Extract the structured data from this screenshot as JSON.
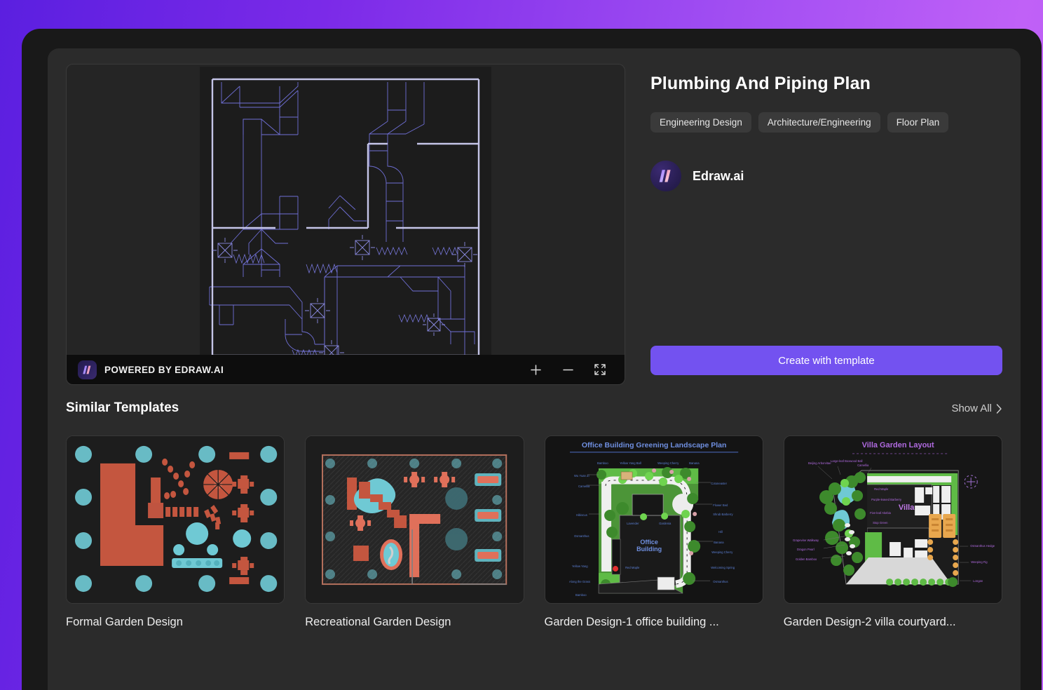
{
  "theme": {
    "bg_gradient_from": "#5b1fe0",
    "bg_gradient_to": "#c061f7",
    "window_bg": "#2b2b2b",
    "frame_bg": "#191919",
    "accent": "#7352f0",
    "tag_bg": "#3a3a3a",
    "cad_line": "#8d8de0",
    "cad_bg": "#1c1c1c"
  },
  "preview": {
    "watermark_text": "POWERED BY EDRAW.AI",
    "logo_icon": "edraw-logo-icon",
    "controls": [
      {
        "name": "zoom-in-button",
        "icon": "plus-icon"
      },
      {
        "name": "zoom-out-button",
        "icon": "minus-icon"
      },
      {
        "name": "fullscreen-button",
        "icon": "expand-icon"
      }
    ]
  },
  "detail": {
    "title": "Plumbing And Piping Plan",
    "tags": [
      "Engineering Design",
      "Architecture/Engineering",
      "Floor Plan"
    ],
    "author": {
      "name": "Edraw.ai",
      "avatar_icon": "edraw-avatar-icon"
    },
    "cta_label": "Create with template"
  },
  "similar": {
    "heading": "Similar Templates",
    "show_all_label": "Show All",
    "show_all_icon": "chevron-right-icon",
    "cards": [
      {
        "title": "Formal Garden Design",
        "thumb_kind": "formal-garden",
        "palette": {
          "bg": "#1d1d1d",
          "solid": "#c4563f",
          "tree": "#7ed8dd"
        }
      },
      {
        "title": "Recreational Garden Design",
        "thumb_kind": "recreational-garden",
        "palette": {
          "bg": "#1d1d1d",
          "plot": "#2a2a2a",
          "solid": "#e0705a",
          "water": "#6fd0d8"
        }
      },
      {
        "title": "Garden Design-1 office building ...",
        "thumb_kind": "office-landscape",
        "palette": {
          "bg": "#141414",
          "green": "#5fbb46",
          "label": "#5b7fd4",
          "path": "#f0f0f0"
        },
        "inner_title": "Office Building Greening Landscape Plan",
        "center_label": "Office\nBuilding",
        "left_labels": [
          "Wu Yuan Zi",
          "Camellia",
          "Hibiscus",
          "Osmanthus",
          "Yellow Yang",
          "Along the Grass",
          "Bamboo"
        ],
        "right_labels": [
          "Cotoneaster",
          "Flower Bed",
          "Shrub Barberry",
          "Hill",
          "Banana",
          "Weeping Cherry",
          "Welcoming Spring",
          "Osmanthus"
        ],
        "top_labels": [
          "Bamboo",
          "Yellow Yang Ball",
          "Weeping Cherry",
          "Banana"
        ],
        "inner_notes": [
          "Lavender",
          "Gardenia",
          "Red Maple"
        ]
      },
      {
        "title": "Garden Design-2 villa courtyard...",
        "thumb_kind": "villa-garden",
        "palette": {
          "bg": "#161616",
          "green": "#52b33c",
          "label": "#b06ae0",
          "water": "#7fd3e8"
        },
        "inner_title": "Villa Garden Layout",
        "center_label": "Villa",
        "left_labels": [
          "Beijing Arborvitae",
          "Large-leaf Boxwood Ball",
          "Camellia",
          "Grapevine Walkway",
          "Dragon Pearl",
          "Golden Bamboo"
        ],
        "right_labels": [
          "Osmanthus Hedge",
          "Weeping Fig",
          "Longan"
        ],
        "inner_notes": [
          "Red Maple",
          "Purple-leaved Barberry",
          "Five-leaf Akebia",
          "Stop Green"
        ]
      }
    ]
  }
}
